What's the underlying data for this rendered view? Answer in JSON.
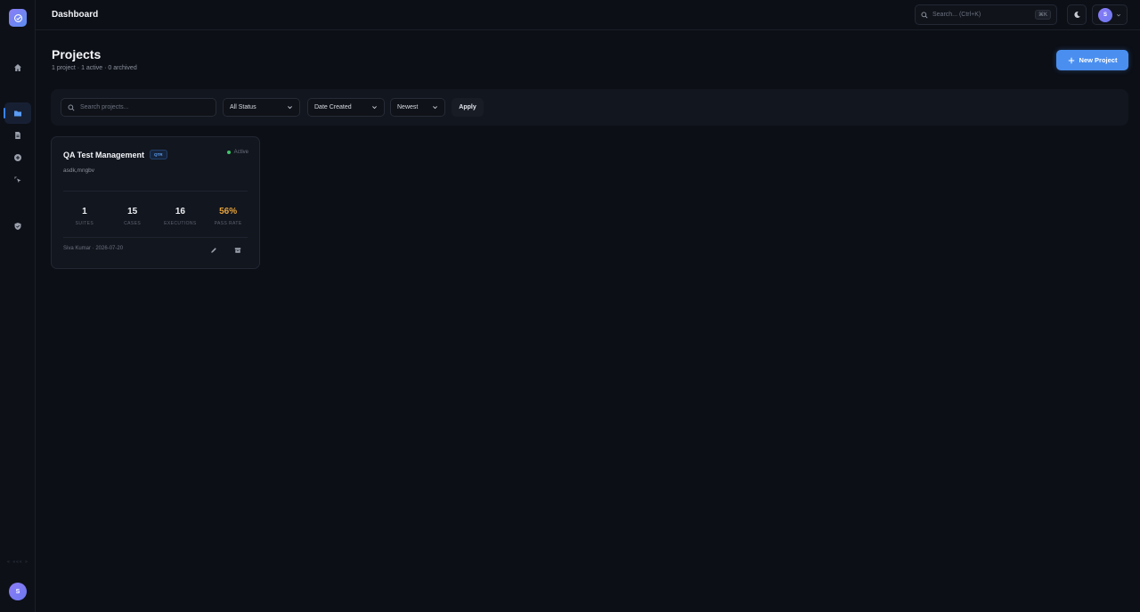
{
  "sidebar": {
    "logo_icon": "check-circle-icon",
    "items": [
      {
        "name": "home",
        "icon": "home-icon"
      },
      {
        "name": "projects",
        "icon": "folder-icon",
        "active": true
      },
      {
        "name": "documents",
        "icon": "document-icon"
      },
      {
        "name": "add",
        "icon": "plus-circle-icon"
      },
      {
        "name": "automation",
        "icon": "pointer-click-icon"
      },
      {
        "name": "reports",
        "icon": "shield-check-icon"
      }
    ],
    "collapse_label": "« ««« »",
    "avatar_initial": "S"
  },
  "header": {
    "title": "Dashboard",
    "search_placeholder": "Search... (Ctrl+K)",
    "shortcut": "⌘K",
    "avatar_initial": "S"
  },
  "page": {
    "title": "Projects",
    "subtitle": "1 project · 1 active · 0 archived",
    "new_button": "New Project"
  },
  "filters": {
    "search_placeholder": "Search projects...",
    "status": "All Status",
    "sort_field": "Date Created",
    "sort_order": "Newest",
    "apply": "Apply"
  },
  "projects": [
    {
      "name": "QA Test Management",
      "key": "QTR",
      "status": "Active",
      "description": "asdk,mngbv",
      "stats": [
        {
          "value": "1",
          "label": "SUITES"
        },
        {
          "value": "15",
          "label": "CASES"
        },
        {
          "value": "16",
          "label": "EXECUTIONS"
        },
        {
          "value": "56%",
          "label": "PASS RATE"
        }
      ],
      "footer": "Siva Kumar · 2026-07-20"
    }
  ],
  "colors": {
    "accent": "#4a8ff0",
    "active_status": "#3fc46a",
    "pass_rate": "#e6a23c",
    "background": "#0c0f16"
  }
}
